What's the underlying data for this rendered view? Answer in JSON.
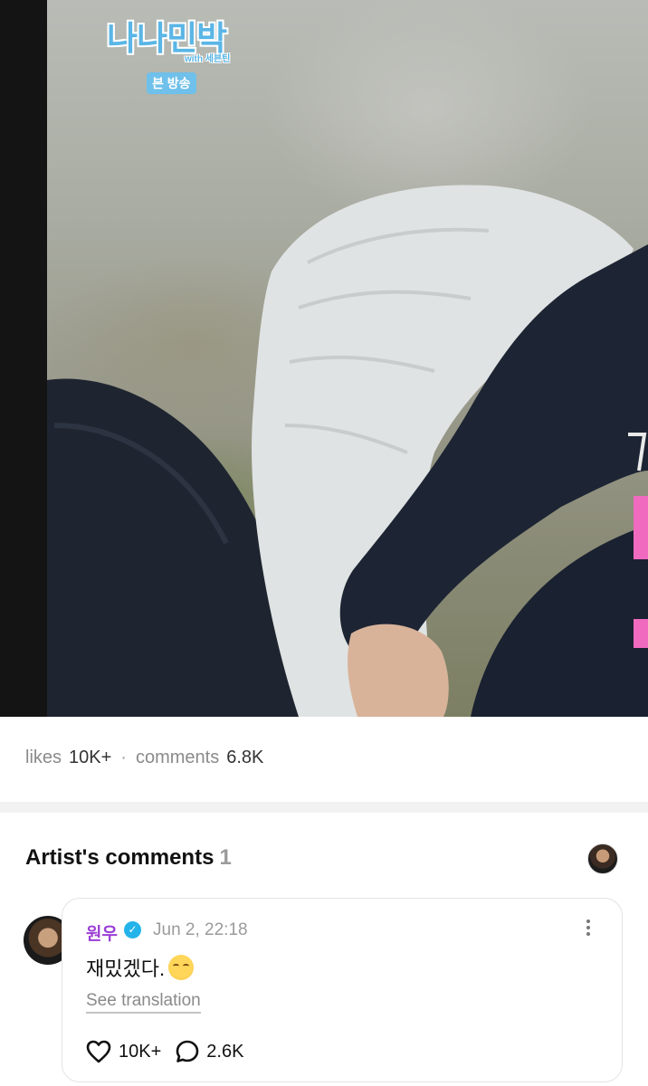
{
  "photo": {
    "logo_title": "나나민박",
    "logo_subtitle": "with 세븐틴",
    "logo_tag": "본 방송"
  },
  "stats": {
    "likes_label": "likes",
    "likes_value": "10K+",
    "separator": "·",
    "comments_label": "comments",
    "comments_value": "6.8K"
  },
  "artist_comments": {
    "title": "Artist's comments",
    "count": "1",
    "comment": {
      "author": "원우",
      "verified": true,
      "timestamp": "Jun 2, 22:18",
      "text": "재밌겠다.",
      "emoji": "smiling-face-icon",
      "translate_label": "See translation",
      "likes": "10K+",
      "replies": "2.6K"
    }
  },
  "colors": {
    "author_name": "#9b3ed6",
    "verified_badge": "#23b3ea",
    "logo": "#5ab6e6"
  }
}
